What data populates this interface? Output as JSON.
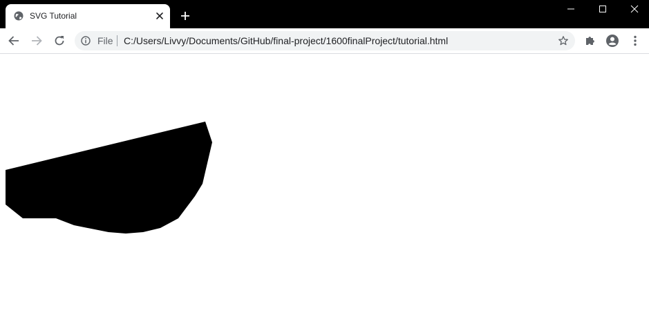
{
  "browser": {
    "tab": {
      "title": "SVG Tutorial",
      "favicon": "globe-icon",
      "close_icon": "close-icon"
    },
    "new_tab_icon": "plus-icon",
    "window_controls": [
      "minimize-icon",
      "maximize-icon",
      "close-icon"
    ],
    "toolbar": {
      "back_icon": "arrow-left-icon",
      "forward_icon": "arrow-right-icon",
      "reload_icon": "reload-icon",
      "omnibox": {
        "security_icon": "info-icon",
        "scheme_label": "File",
        "url": "C:/Users/Livvy/Documents/GitHub/final-project/1600finalProject/tutorial.html",
        "bookmark_icon": "star-icon"
      },
      "extensions_icon": "puzzle-icon",
      "profile_icon": "account-icon",
      "menu_icon": "more-vert-icon"
    },
    "colors": {
      "tabstrip": "#000000",
      "tab": "#ffffff",
      "omnibox": "#f1f3f4",
      "icon": "#5f6368"
    }
  },
  "page": {
    "background": "#ffffff",
    "shape": {
      "kind": "polygon",
      "fill": "#000000"
    }
  }
}
